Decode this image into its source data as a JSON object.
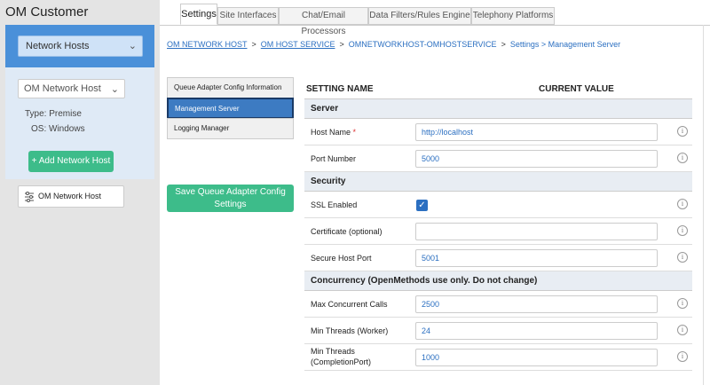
{
  "app_title": "OM Customer",
  "sidebar": {
    "nav_select": "Network Hosts",
    "host_select": "OM Network Host",
    "type_label": "Type:",
    "type_value": "Premise",
    "os_label": "OS:",
    "os_value": "Windows",
    "add_button": "+ Add Network Host",
    "host_item": "OM Network Host"
  },
  "tabs": [
    {
      "label": "Settings",
      "active": true
    },
    {
      "label": "Site Interfaces",
      "active": false
    },
    {
      "label": "Chat/Email Processors",
      "active": false
    },
    {
      "label": "Data Filters/Rules Engine",
      "active": false
    },
    {
      "label": "Telephony Platforms",
      "active": false
    }
  ],
  "breadcrumb": {
    "link1": "OM NETWORK HOST",
    "link2": "OM HOST SERVICE",
    "link3": "OMNETWORKHOST-OMHOSTSERVICE",
    "current": "Settings > Management Server",
    "sep": ">"
  },
  "config_menu": [
    {
      "label": "Queue Adapter Config Information",
      "active": false
    },
    {
      "label": "Management Server",
      "active": true
    },
    {
      "label": "Logging Manager",
      "active": false
    }
  ],
  "save_button": "Save Queue Adapter Config Settings",
  "table": {
    "col_name": "SETTING NAME",
    "col_value": "CURRENT VALUE",
    "sections": [
      {
        "title": "Server",
        "rows": [
          {
            "label": "Host Name",
            "required": "*",
            "value": "http://localhost"
          },
          {
            "label": "Port Number",
            "value": "5000"
          }
        ]
      },
      {
        "title": "Security",
        "rows": [
          {
            "label": "SSL Enabled",
            "checkbox": true
          },
          {
            "label": "Certificate (optional)",
            "value": ""
          },
          {
            "label": "Secure Host Port",
            "value": "5001"
          }
        ]
      },
      {
        "title": "Concurrency (OpenMethods use only. Do not change)",
        "rows": [
          {
            "label": "Max Concurrent Calls",
            "value": "2500"
          },
          {
            "label": "Min Threads (Worker)",
            "value": "24"
          },
          {
            "label": "Min Threads (CompletionPort)",
            "value": "1000"
          }
        ]
      }
    ]
  },
  "colors": {
    "accent_blue": "#4a90d9",
    "button_green": "#3dbc8a",
    "link_blue": "#2b6fc1",
    "active_menu": "#3d7bc2"
  },
  "icons": {
    "info": "info-circle-icon",
    "checkbox": "checkmark-icon",
    "host_item": "sliders-icon",
    "select": "chevron-down-icon"
  }
}
